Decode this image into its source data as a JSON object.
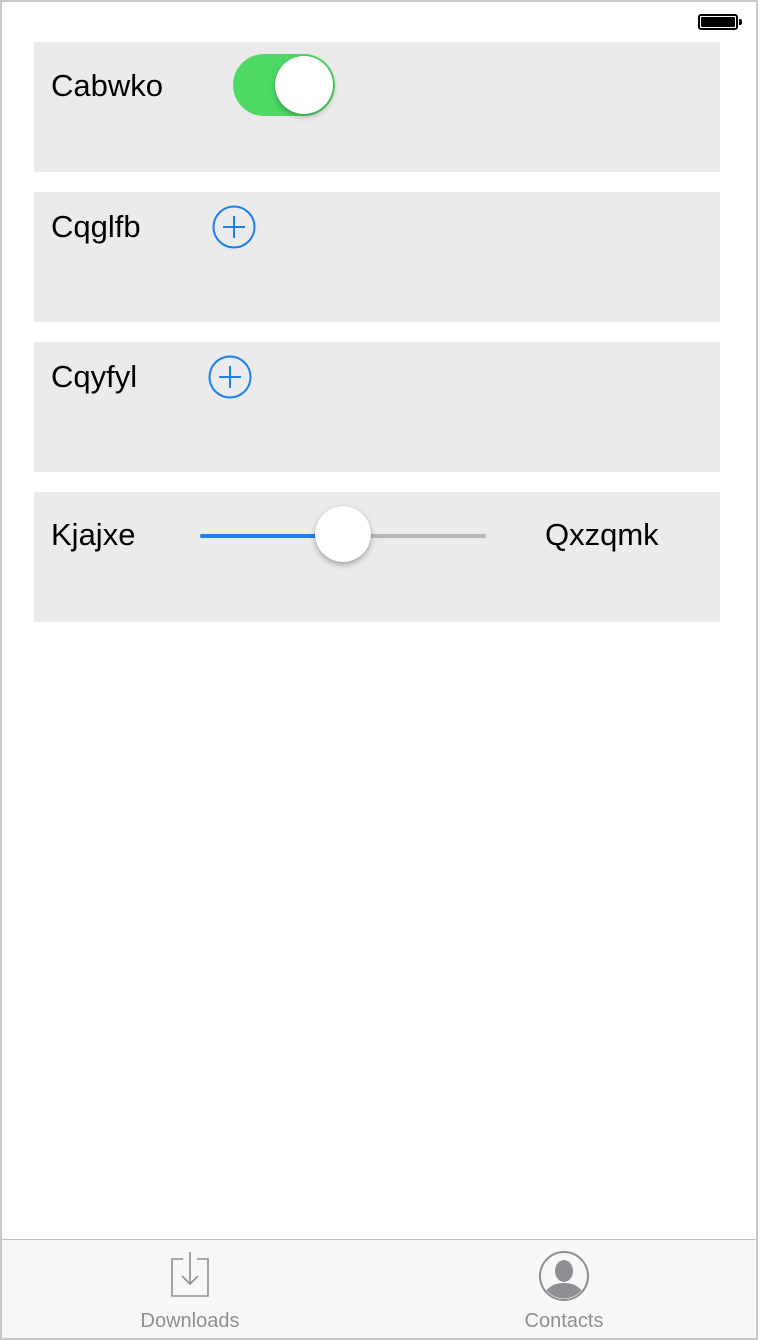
{
  "colors": {
    "switch_on": "#4cd964",
    "accent": "#1a7ff0",
    "card_background": "#ebebeb",
    "tab_inactive": "#8e8e93"
  },
  "status_bar": {
    "battery_icon": "battery-full-icon"
  },
  "rows": [
    {
      "label": "Cabwko",
      "control": "switch",
      "switch_on": true
    },
    {
      "label": "Cqglfb",
      "control": "add-button",
      "icon": "plus-circle-icon"
    },
    {
      "label": "Cqyfyl",
      "control": "add-button",
      "icon": "plus-circle-icon"
    },
    {
      "label": "Kjajxe",
      "control": "slider",
      "slider_value": 0.5,
      "right_label": "Qxzqmk"
    }
  ],
  "tab_bar": {
    "tabs": [
      {
        "label": "Downloads",
        "icon": "download-tray-icon"
      },
      {
        "label": "Contacts",
        "icon": "contact-person-icon"
      }
    ]
  }
}
